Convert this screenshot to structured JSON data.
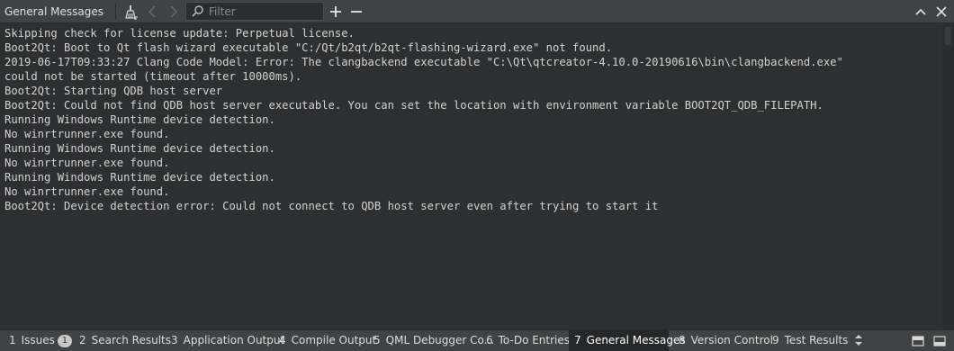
{
  "toolbar": {
    "title": "General Messages",
    "filter_placeholder": "Filter"
  },
  "output": {
    "lines": [
      "Skipping check for license update: Perpetual license.",
      "Boot2Qt: Boot to Qt flash wizard executable \"C:/Qt/b2qt/b2qt-flashing-wizard.exe\" not found.",
      "2019-06-17T09:33:27 Clang Code Model: Error: The clangbackend executable \"C:\\Qt\\qtcreator-4.10.0-20190616\\bin\\clangbackend.exe\"",
      "could not be started (timeout after 10000ms).",
      "Boot2Qt: Starting QDB host server",
      "Boot2Qt: Could not find QDB host server executable. You can set the location with environment variable BOOT2QT_QDB_FILEPATH.",
      "Running Windows Runtime device detection.",
      "No winrtrunner.exe found.",
      "Running Windows Runtime device detection.",
      "No winrtrunner.exe found.",
      "Running Windows Runtime device detection.",
      "No winrtrunner.exe found.",
      "Boot2Qt: Device detection error: Could not connect to QDB host server even after trying to start it"
    ]
  },
  "bottom_tabs": [
    {
      "num": "1",
      "label": "Issues",
      "badge": "1"
    },
    {
      "num": "2",
      "label": "Search Results"
    },
    {
      "num": "3",
      "label": "Application Output"
    },
    {
      "num": "4",
      "label": "Compile Output"
    },
    {
      "num": "5",
      "label": "QML Debugger Co..."
    },
    {
      "num": "6",
      "label": "To-Do Entries"
    },
    {
      "num": "7",
      "label": "General Messages",
      "active": true
    },
    {
      "num": "8",
      "label": "Version Control"
    },
    {
      "num": "9",
      "label": "Test Results"
    }
  ],
  "colors": {
    "toolbar_bg": "#404244",
    "output_bg": "#2e2f30",
    "text": "#d2d2d2",
    "active_tab_bg": "#262728"
  }
}
